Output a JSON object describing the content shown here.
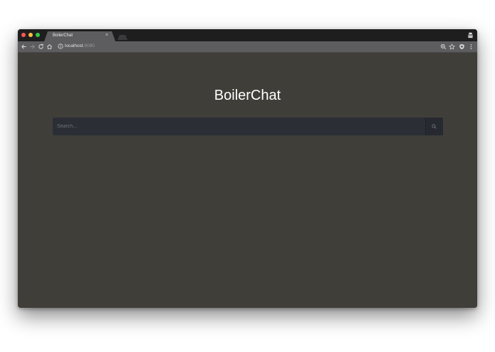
{
  "browser": {
    "tab": {
      "title": "BoilerChat",
      "close_glyph": "×"
    },
    "address_bar": {
      "host": "localhost",
      "port": ":8080"
    },
    "icons": [
      "back-icon",
      "forward-icon",
      "reload-icon",
      "home-icon",
      "info-icon",
      "zoom-icon",
      "star-icon",
      "extension-shield-icon",
      "menu-dots-icon",
      "profile-icon"
    ]
  },
  "page": {
    "title": "BoilerChat",
    "search": {
      "placeholder": "Search...",
      "value": ""
    }
  },
  "colors": {
    "page_background": "#403e39",
    "search_background": "#2b2e35",
    "tabstrip": "#1e1e1f",
    "toolbar": "#5d5d5f",
    "traffic_close": "#fc5753",
    "traffic_minimize": "#fdbc40",
    "traffic_zoom": "#33c748"
  }
}
